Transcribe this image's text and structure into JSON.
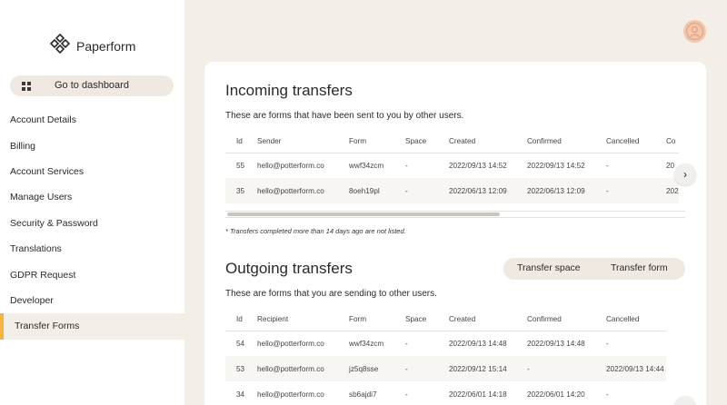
{
  "brand": {
    "name": "Paperform"
  },
  "sidebar": {
    "dashboard_label": "Go to dashboard",
    "items": [
      {
        "label": "Account Details"
      },
      {
        "label": "Billing"
      },
      {
        "label": "Account Services"
      },
      {
        "label": "Manage Users"
      },
      {
        "label": "Security & Password"
      },
      {
        "label": "Translations"
      },
      {
        "label": "GDPR Request"
      },
      {
        "label": "Developer"
      },
      {
        "label": "Transfer Forms",
        "active": true
      }
    ]
  },
  "incoming": {
    "title": "Incoming transfers",
    "description": "These are forms that have been sent to you by other users.",
    "columns": [
      "Id",
      "Sender",
      "Form",
      "Space",
      "Created",
      "Confirmed",
      "Cancelled",
      "Co"
    ],
    "rows": [
      [
        "55",
        "hello@potterform.co",
        "wwf34zcm",
        "-",
        "2022/09/13 14:52",
        "2022/09/13 14:52",
        "-",
        "20"
      ],
      [
        "35",
        "hello@potterform.co",
        "8oeh19pl",
        "-",
        "2022/06/13 12:09",
        "2022/06/13 12:09",
        "-",
        "202"
      ]
    ],
    "footnote": "* Transfers completed more than 14 days ago are not listed."
  },
  "outgoing": {
    "title": "Outgoing transfers",
    "description": "These are forms that you are sending to other users.",
    "transfer_space_label": "Transfer space",
    "transfer_form_label": "Transfer form",
    "columns": [
      "Id",
      "Recipient",
      "Form",
      "Space",
      "Created",
      "Confirmed",
      "Cancelled"
    ],
    "rows": [
      [
        "54",
        "hello@potterform.co",
        "wwf34zcm",
        "-",
        "2022/09/13 14:48",
        "2022/09/13 14:48",
        "-"
      ],
      [
        "53",
        "hello@potterform.co",
        "jz5q8sse",
        "-",
        "2022/09/12 15:14",
        "-",
        "2022/09/13 14:44"
      ],
      [
        "34",
        "hello@potterform.co",
        "sb6ajdi7",
        "-",
        "2022/06/01 14:18",
        "2022/06/01 14:20",
        "-"
      ]
    ]
  },
  "icons": {
    "brand_logo": "paperform-logo-icon",
    "dashboard": "grid-icon",
    "avatar": "user-avatar-icon",
    "scroll_next": "chevron-right-icon"
  },
  "colors": {
    "background": "#f3efe8",
    "accent": "#f2b544",
    "avatar": "#f1c7ad",
    "pill": "#efe9e1"
  }
}
